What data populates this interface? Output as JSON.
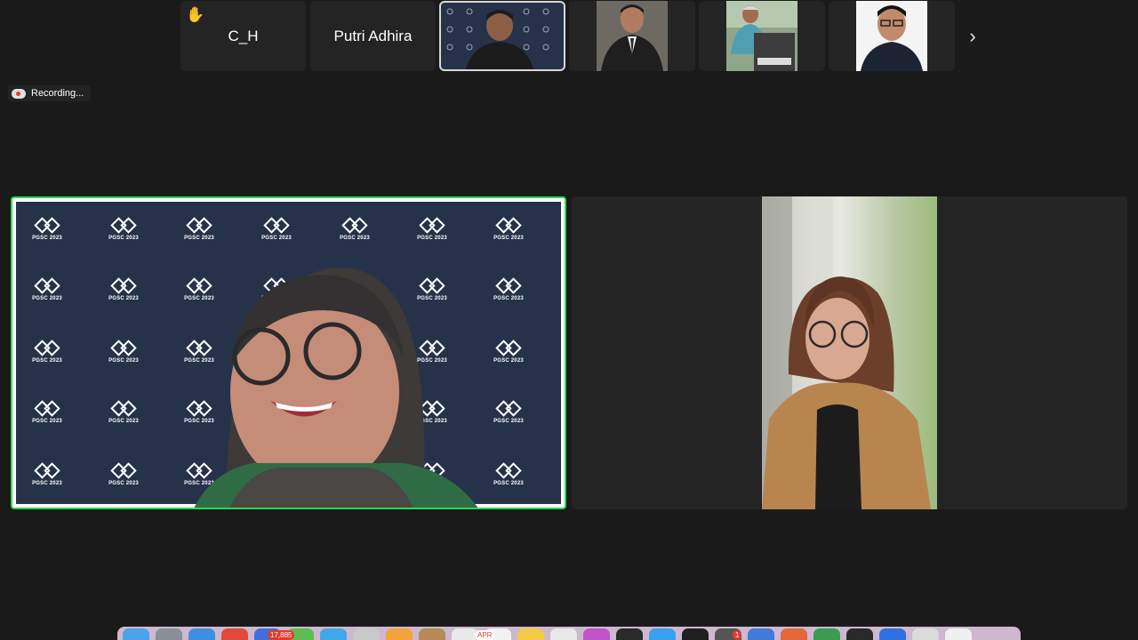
{
  "participants_strip": [
    {
      "name": "C_H",
      "raised_hand": true
    },
    {
      "name": "Putri Adhira",
      "raised_hand": false
    }
  ],
  "icons": {
    "raise_hand": "✋",
    "next": "›"
  },
  "recording": {
    "label": "Recording..."
  },
  "speaker_tile": {
    "backdrop_text": "PGSC 2023",
    "highlight_color": "#2fd655"
  },
  "dock": {
    "badges": [
      "17,885",
      "APR",
      "1"
    ]
  }
}
